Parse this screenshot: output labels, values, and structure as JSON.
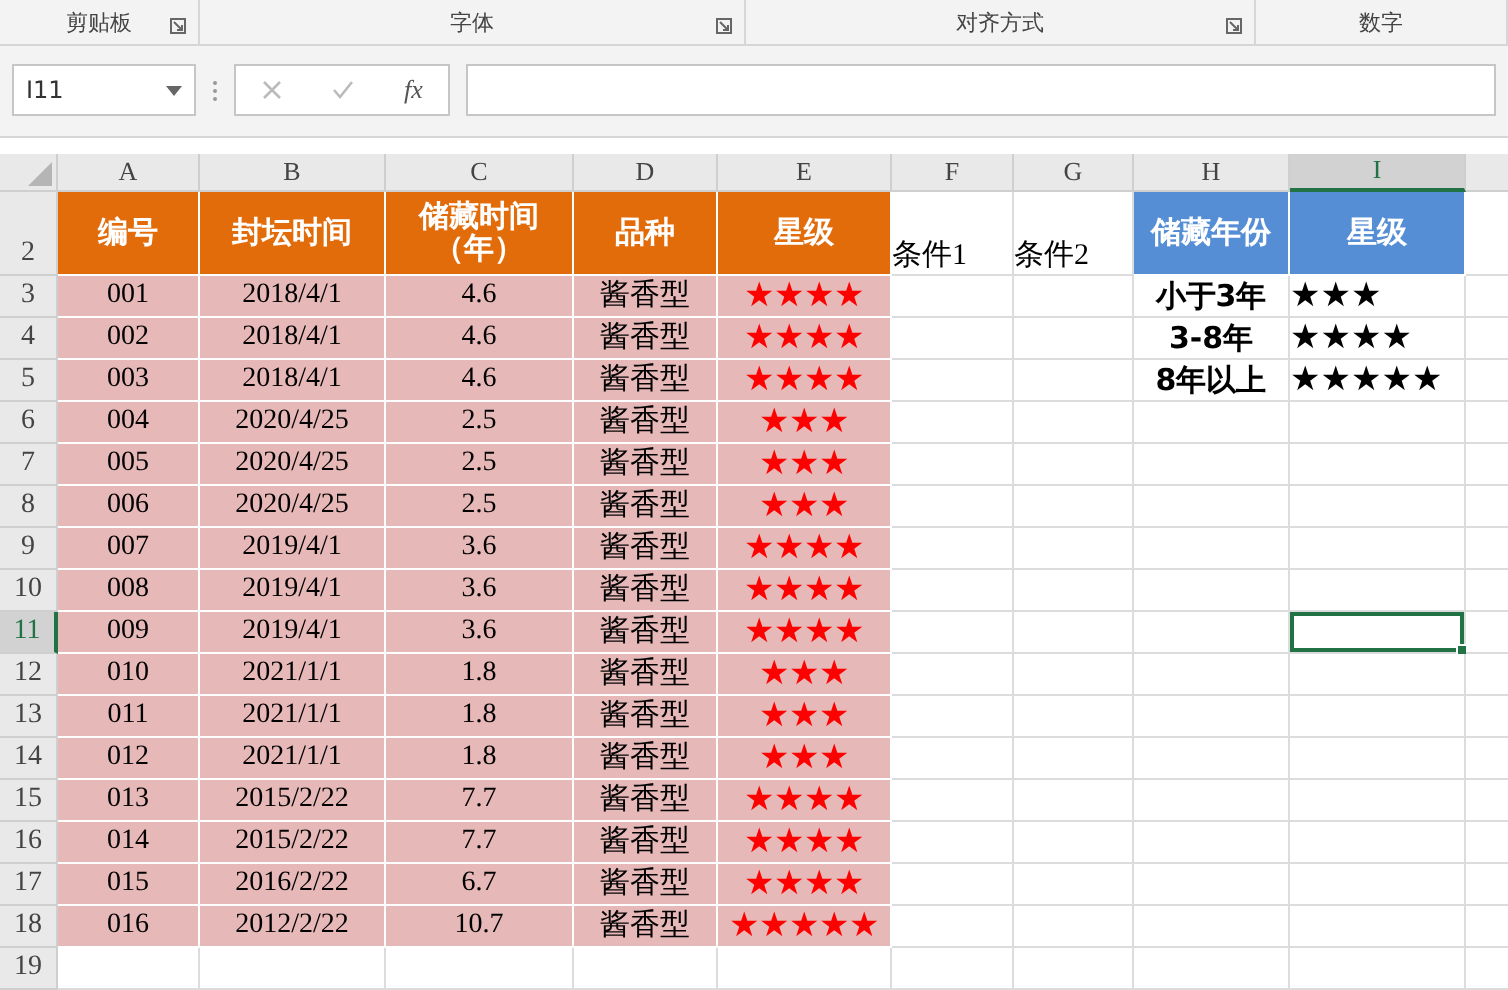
{
  "ribbon_groups": [
    {
      "label": "剪贴板",
      "launcher": true
    },
    {
      "label": "字体",
      "launcher": true
    },
    {
      "label": "对齐方式",
      "launcher": true
    },
    {
      "label": "数字",
      "launcher": false
    }
  ],
  "name_box": {
    "value": "I11"
  },
  "formula_bar": {
    "function_label": "fx"
  },
  "column_headers": [
    {
      "label": "A",
      "selected": false
    },
    {
      "label": "B",
      "selected": false
    },
    {
      "label": "C",
      "selected": false
    },
    {
      "label": "D",
      "selected": false
    },
    {
      "label": "E",
      "selected": false
    },
    {
      "label": "F",
      "selected": false
    },
    {
      "label": "G",
      "selected": false
    },
    {
      "label": "H",
      "selected": false
    },
    {
      "label": "I",
      "selected": true
    }
  ],
  "row_numbers": [
    {
      "label": "2",
      "selected": false
    },
    {
      "label": "3",
      "selected": false
    },
    {
      "label": "4",
      "selected": false
    },
    {
      "label": "5",
      "selected": false
    },
    {
      "label": "6",
      "selected": false
    },
    {
      "label": "7",
      "selected": false
    },
    {
      "label": "8",
      "selected": false
    },
    {
      "label": "9",
      "selected": false
    },
    {
      "label": "10",
      "selected": false
    },
    {
      "label": "11",
      "selected": true
    },
    {
      "label": "12",
      "selected": false
    },
    {
      "label": "13",
      "selected": false
    },
    {
      "label": "14",
      "selected": false
    },
    {
      "label": "15",
      "selected": false
    },
    {
      "label": "16",
      "selected": false
    },
    {
      "label": "17",
      "selected": false
    },
    {
      "label": "18",
      "selected": false
    },
    {
      "label": "19",
      "selected": false
    }
  ],
  "main_table": {
    "header": [
      [
        "编号"
      ],
      [
        "封坛时间"
      ],
      [
        "储藏时间",
        "（年）"
      ],
      [
        "品种"
      ],
      [
        "星级"
      ]
    ],
    "rows": [
      [
        "001",
        "2018/4/1",
        "4.6",
        "酱香型",
        "★★★★"
      ],
      [
        "002",
        "2018/4/1",
        "4.6",
        "酱香型",
        "★★★★"
      ],
      [
        "003",
        "2018/4/1",
        "4.6",
        "酱香型",
        "★★★★"
      ],
      [
        "004",
        "2020/4/25",
        "2.5",
        "酱香型",
        "★★★"
      ],
      [
        "005",
        "2020/4/25",
        "2.5",
        "酱香型",
        "★★★"
      ],
      [
        "006",
        "2020/4/25",
        "2.5",
        "酱香型",
        "★★★"
      ],
      [
        "007",
        "2019/4/1",
        "3.6",
        "酱香型",
        "★★★★"
      ],
      [
        "008",
        "2019/4/1",
        "3.6",
        "酱香型",
        "★★★★"
      ],
      [
        "009",
        "2019/4/1",
        "3.6",
        "酱香型",
        "★★★★"
      ],
      [
        "010",
        "2021/1/1",
        "1.8",
        "酱香型",
        "★★★"
      ],
      [
        "011",
        "2021/1/1",
        "1.8",
        "酱香型",
        "★★★"
      ],
      [
        "012",
        "2021/1/1",
        "1.8",
        "酱香型",
        "★★★"
      ],
      [
        "013",
        "2015/2/22",
        "7.7",
        "酱香型",
        "★★★★"
      ],
      [
        "014",
        "2015/2/22",
        "7.7",
        "酱香型",
        "★★★★"
      ],
      [
        "015",
        "2016/2/22",
        "6.7",
        "酱香型",
        "★★★★"
      ],
      [
        "016",
        "2012/2/22",
        "10.7",
        "酱香型",
        "★★★★★"
      ]
    ]
  },
  "criteria": [
    "条件1",
    "条件2"
  ],
  "lookup_table": {
    "header": [
      "储藏年份",
      "星级"
    ],
    "rows": [
      [
        "小于3年",
        "★★★"
      ],
      [
        "3-8年",
        "★★★★"
      ],
      [
        "8年以上",
        "★★★★★"
      ]
    ]
  }
}
